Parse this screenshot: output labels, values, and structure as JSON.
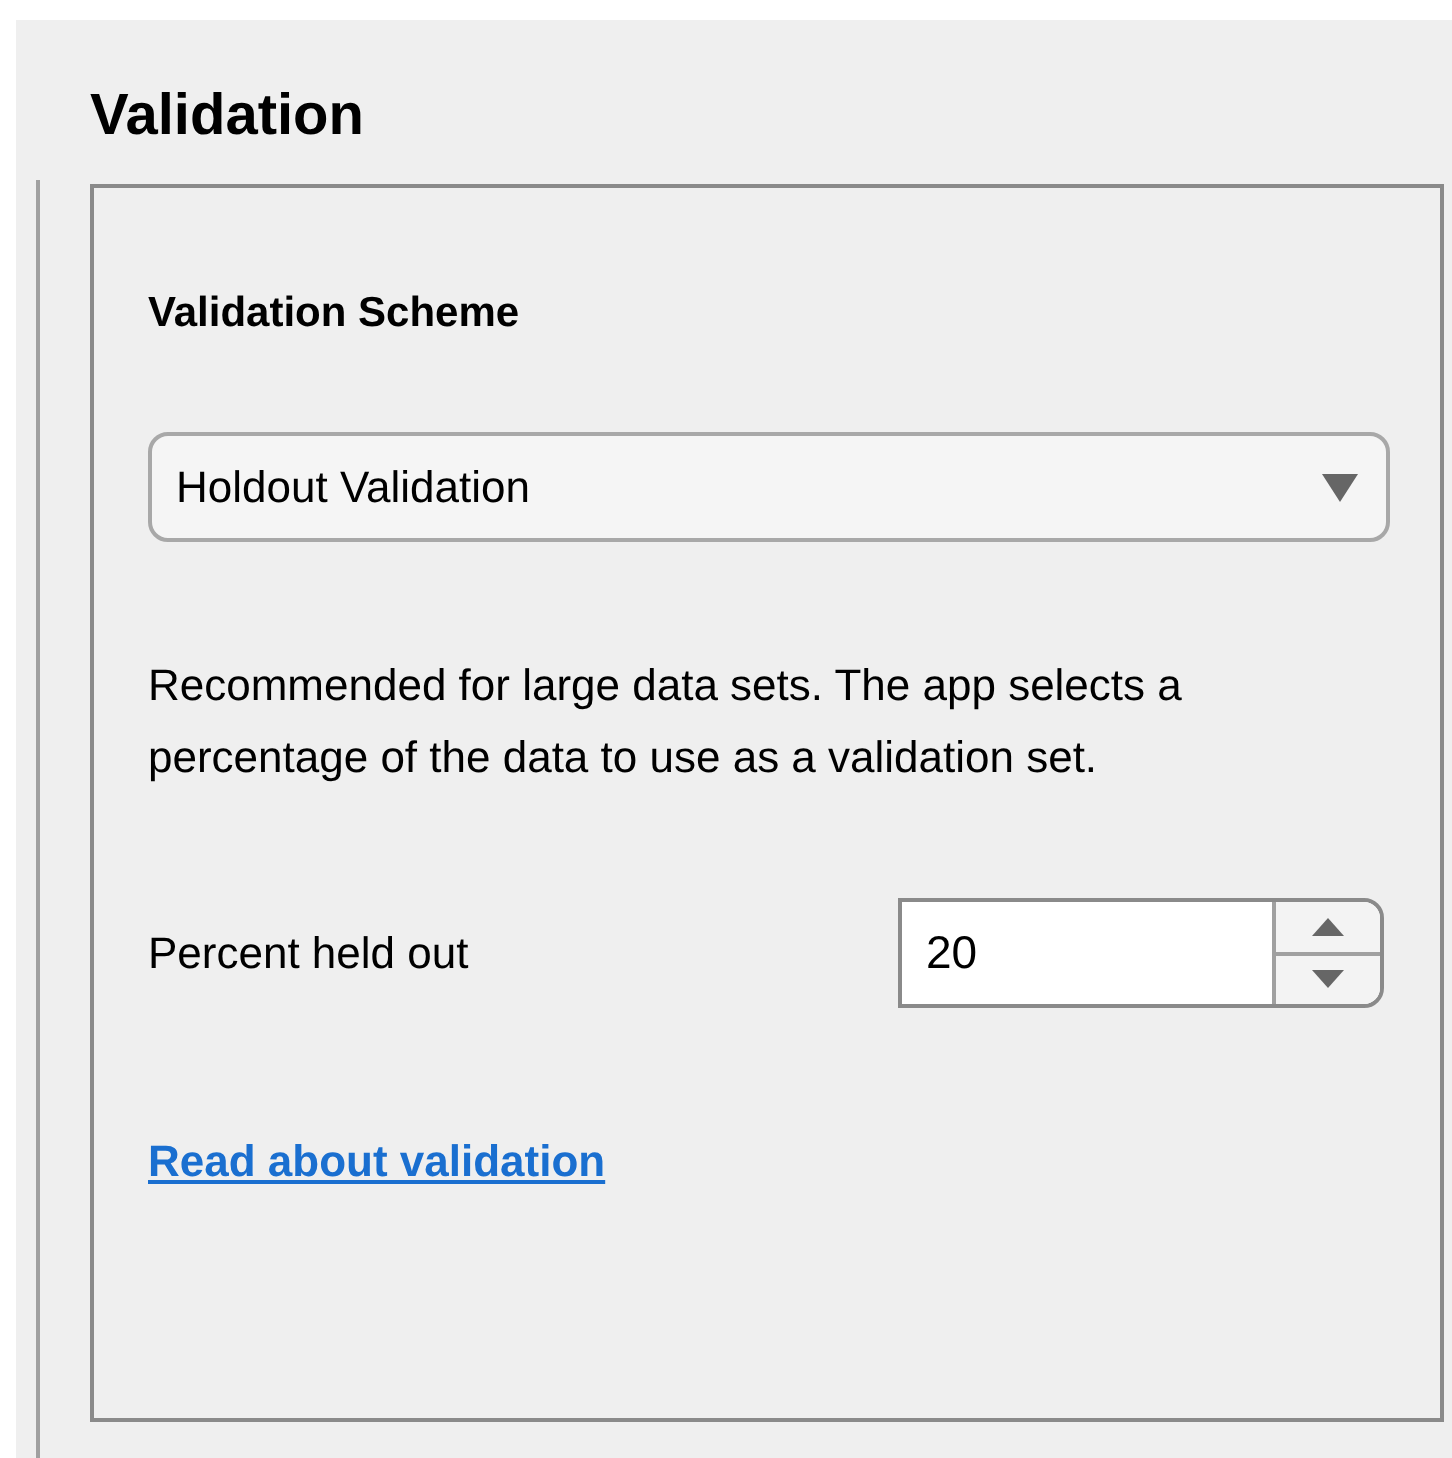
{
  "section_title": "Validation",
  "scheme": {
    "label": "Validation Scheme",
    "value": "Holdout Validation",
    "description": "Recommended for large data sets. The app selects a percentage of the data to use as a validation set."
  },
  "percent": {
    "label": "Percent held out",
    "value": "20"
  },
  "link": "Read about validation"
}
